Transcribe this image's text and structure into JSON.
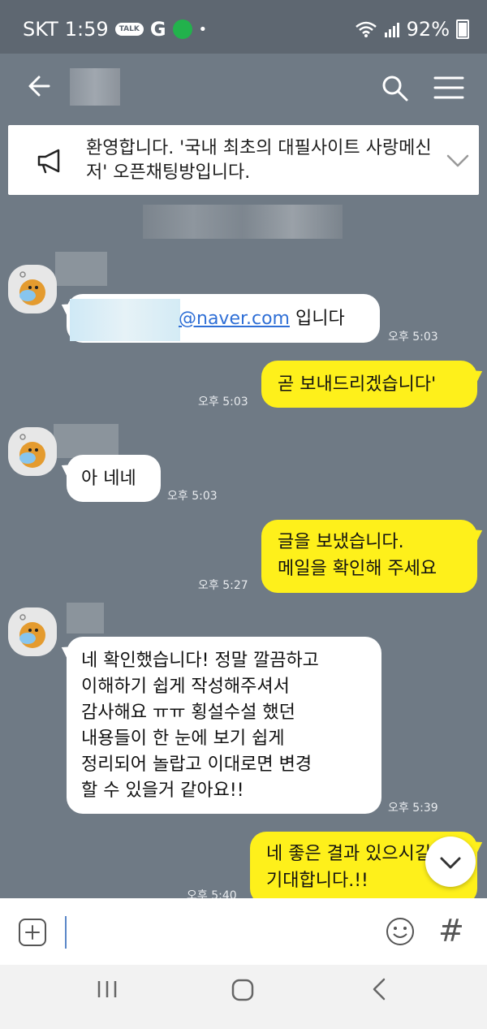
{
  "status_bar": {
    "carrier": "SKT",
    "time": "1:59",
    "talk_badge": "TALK",
    "g_badge": "G",
    "dot": "•",
    "battery": "92%",
    "icons": [
      "kakaotalk-notification-icon",
      "google-icon",
      "app-notification-icon",
      "wifi-icon",
      "signal-icon",
      "battery-icon"
    ]
  },
  "header": {
    "icons": [
      "back-arrow-icon",
      "search-icon",
      "menu-icon"
    ]
  },
  "notice": {
    "text": "환영합니다. '국내 최초의 대필사이트 사랑메신저' 오픈채팅방입니다.",
    "icons": [
      "megaphone-icon",
      "chevron-down-icon"
    ]
  },
  "messages": [
    {
      "side": "left",
      "email_suffix": "@naver.com",
      "text_after": " 입니다",
      "time": "오후 5:03"
    },
    {
      "side": "right",
      "text": "곧 보내드리겠습니다'",
      "time": "오후 5:03"
    },
    {
      "side": "left",
      "text": "아 네네",
      "time": "오후 5:03"
    },
    {
      "side": "right",
      "line1": "글을 보냈습니다.",
      "line2": "메일을 확인해 주세요",
      "time": "오후 5:27"
    },
    {
      "side": "left",
      "lines": [
        "네 확인했습니다! 정말 깔끔하고",
        "이해하기 쉽게 작성해주셔서",
        "감사해요 ㅠㅠ 횡설수설 했던",
        "내용들이 한 눈에 보기 쉽게",
        "정리되어 놀랍고 이대로면 변경",
        "할 수 있을거 같아요!!"
      ],
      "time": "오후 5:39"
    },
    {
      "side": "right",
      "line1": "네 좋은 결과 있으시길",
      "line2": "기대합니다.!!",
      "time": "오후 5:40"
    }
  ],
  "composer": {
    "icons": [
      "plus-icon",
      "emoji-icon",
      "hash-icon"
    ],
    "hash": "#"
  },
  "colors": {
    "background": "#6f7a85",
    "my_bubble": "#fef01b",
    "their_bubble": "#ffffff"
  }
}
